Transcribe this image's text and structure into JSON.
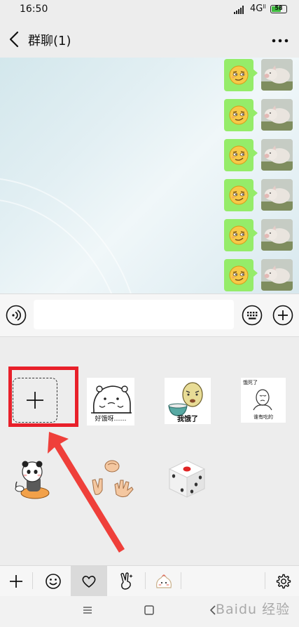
{
  "status_bar": {
    "time": "16:50",
    "network": "4G",
    "network_sub": "ll",
    "battery": "58",
    "battery_level": 0.58
  },
  "header": {
    "title": "群聊(1)",
    "back_icon": "chevron-left-icon",
    "more_icon": "more-dots-icon"
  },
  "chat": {
    "messages": [
      {
        "type": "emoji",
        "emoji": "smirk-face",
        "sender": "self"
      },
      {
        "type": "emoji",
        "emoji": "smirk-face",
        "sender": "self"
      },
      {
        "type": "emoji",
        "emoji": "smirk-face",
        "sender": "self"
      },
      {
        "type": "emoji",
        "emoji": "smirk-face",
        "sender": "self"
      },
      {
        "type": "emoji",
        "emoji": "smirk-face",
        "sender": "self"
      },
      {
        "type": "emoji",
        "emoji": "smirk-face",
        "sender": "self"
      }
    ],
    "bubble_color": "#95ec69"
  },
  "input_bar": {
    "value": "",
    "placeholder": "",
    "voice_icon": "voice-icon",
    "keyboard_icon": "keyboard-icon",
    "more_icon": "plus-circle-icon"
  },
  "emoji_panel": {
    "stickers": [
      {
        "name": "add-custom-sticker",
        "caption": ""
      },
      {
        "name": "hungry-hamster-sticker",
        "caption": "好饿呀……"
      },
      {
        "name": "hungry-bowl-face-sticker",
        "caption": "我饿了"
      },
      {
        "name": "hungry-stickman-sticker",
        "caption_top": "饿死了",
        "caption_bottom": "谁有吃的"
      },
      {
        "name": "panda-sticker",
        "caption": ""
      },
      {
        "name": "rock-paper-scissors-sticker",
        "caption": ""
      },
      {
        "name": "dice-sticker",
        "caption": ""
      }
    ],
    "highlight_color": "#e8202a"
  },
  "tab_bar": {
    "tabs": [
      {
        "name": "add",
        "icon": "plus-icon"
      },
      {
        "name": "emoji",
        "icon": "smile-icon"
      },
      {
        "name": "favorites",
        "icon": "heart-icon",
        "selected": true
      },
      {
        "name": "gestures",
        "icon": "victory-hand-icon"
      },
      {
        "name": "sticker-pack",
        "icon": "bun-character-icon"
      }
    ],
    "settings_icon": "gear-icon"
  },
  "nav_bar": {
    "menu_icon": "menu-icon",
    "home_icon": "home-square-icon",
    "back_icon": "back-triangle-icon"
  },
  "watermark": "Baidu 经验"
}
